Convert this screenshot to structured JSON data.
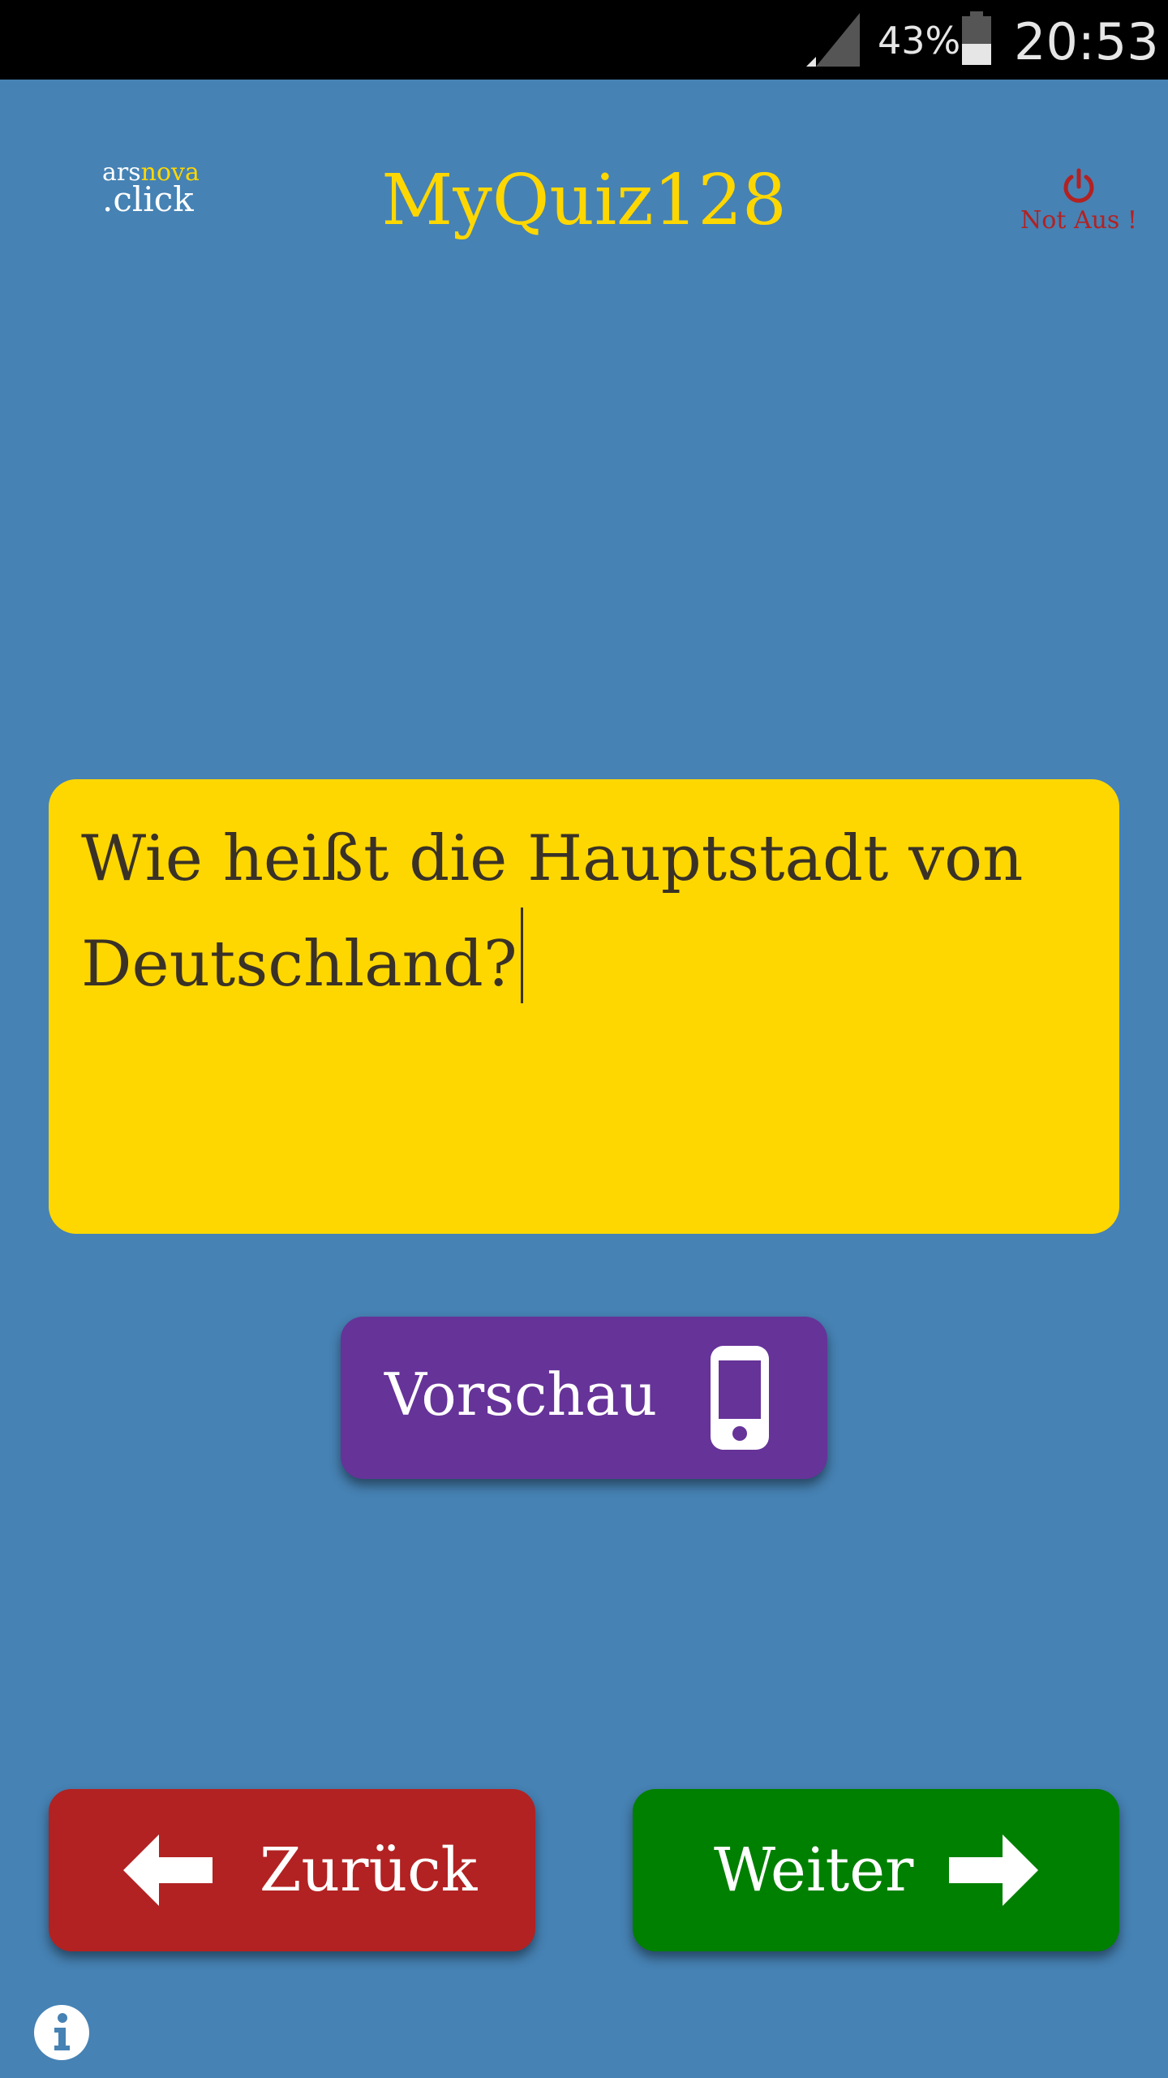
{
  "status_bar": {
    "battery_percent": "43%",
    "battery_level": 0.43,
    "time": "20:53",
    "icons": [
      "signal-icon",
      "battery-icon"
    ]
  },
  "header": {
    "logo": {
      "part1": "ars",
      "part2": "nova",
      "part3": ".click"
    },
    "title": "MyQuiz128",
    "stop_label": "Not Aus !",
    "stop_icon": "power-icon"
  },
  "question": {
    "text": "Wie heißt die Hauptstadt von Deutschland?"
  },
  "preview": {
    "label": "Vorschau",
    "icon": "smartphone-icon"
  },
  "navigation": {
    "back_label": "Zurück",
    "back_icon": "arrow-left-icon",
    "next_label": "Weiter",
    "next_icon": "arrow-right-icon"
  },
  "footer": {
    "info_icon": "info-icon"
  },
  "colors": {
    "background": "#4682B4",
    "title": "#FFD700",
    "question_box": "#FFD700",
    "question_text": "#3a3226",
    "preview_button": "#663399",
    "back_button": "#B22222",
    "next_button": "#008000",
    "stop_button": "#B22222"
  }
}
